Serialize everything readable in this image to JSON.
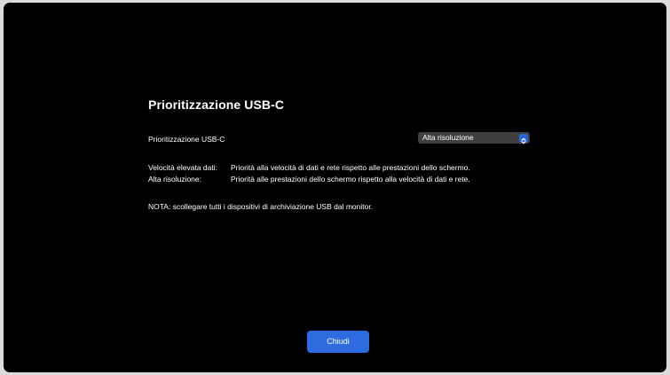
{
  "dialog": {
    "title": "Prioritizzazione USB-C",
    "setting_label": "Prioritizzazione USB-C",
    "dropdown": {
      "selected": "Alta risoluzione"
    },
    "descriptions": [
      {
        "term": "Velocità elevata dati:",
        "text": "Priorità alla velocità di dati e rete rispetto alle prestazioni dello schermo."
      },
      {
        "term": "Alta risoluzione:",
        "text": "Priorità alle prestazioni dello schermo rispetto alla velocità di dati e rete."
      }
    ],
    "note": "NOTA: scollegare tutti i dispositivi di archiviazione USB dal monitor.",
    "close_label": "Chiudi"
  },
  "colors": {
    "background": "#000000",
    "accent": "#2d6bde",
    "dropdown_bg": "#3f3f3f"
  },
  "icons": {
    "dropdown": "chevron-up-down-icon"
  }
}
